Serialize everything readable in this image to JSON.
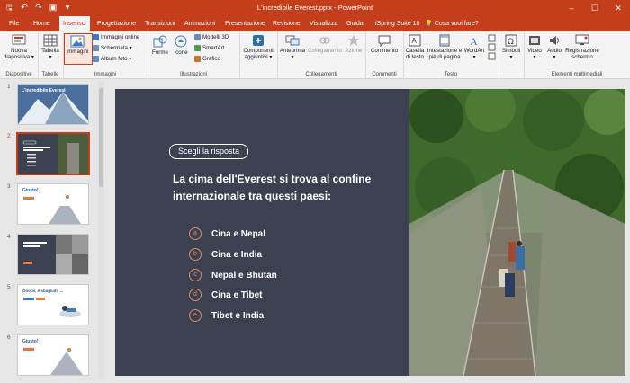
{
  "window": {
    "title": "L'incredibile Everest.pptx  -  PowerPoint",
    "minimize": "–",
    "maximize": "☐",
    "close": "✕"
  },
  "qat": {
    "save": "🖫",
    "undo": "↶",
    "redo": "↷",
    "present": "▣",
    "more": "▾"
  },
  "tabs": [
    {
      "label": "File"
    },
    {
      "label": "Home"
    },
    {
      "label": "Inserisci"
    },
    {
      "label": "Progettazione"
    },
    {
      "label": "Transizioni"
    },
    {
      "label": "Animazioni"
    },
    {
      "label": "Presentazione"
    },
    {
      "label": "Revisione"
    },
    {
      "label": "Visualizza"
    },
    {
      "label": "Guida"
    },
    {
      "label": "iSpring Suite 10"
    },
    {
      "label": "Cosa vuoi fare?"
    }
  ],
  "ribbon": {
    "groups": {
      "diapositive": "Diapositive",
      "tabelle": "Tabelle",
      "immagini": "Immagini",
      "illustrazioni": "Illustrazioni",
      "collegamenti": "Collegamenti",
      "commenti": "Commenti",
      "testo": "Testo",
      "media": "Elementi multimediali"
    },
    "buttons": {
      "nuova": "Nuova",
      "nuova2": "diapositiva ▾",
      "tabella": "Tabella",
      "tabella2": "▾",
      "immagini": "Immagini",
      "immagini_online": "Immagini online",
      "schermata": "Schermata ▾",
      "album": "Album foto ▾",
      "forme": "Forme",
      "icone": "Icone",
      "modelli3d": "Modelli 3D",
      "smartart": "SmartArt",
      "grafico": "Grafico",
      "componenti": "Componenti",
      "componenti2": "aggiuntivi ▾",
      "anteprima": "Anteprima",
      "anteprima2": "▾",
      "collegamento": "Collegamento",
      "azione": "Azione",
      "commento": "Commento",
      "casella": "Casella",
      "casella2": "di testo",
      "intestazione": "Intestazione e",
      "intestazione2": "piè di pagina",
      "wordart": "WordArt",
      "wordart2": "▾",
      "simboli": "Simboli",
      "simboli2": "▾",
      "video": "Video",
      "video2": "▾",
      "audio": "Audio",
      "audio2": "▾",
      "registrazione": "Registrazione",
      "registrazione2": "schermo"
    }
  },
  "thumbnails": [
    {
      "number": "1",
      "title": "L'incredibile Everest"
    },
    {
      "number": "2",
      "title": ""
    },
    {
      "number": "3",
      "title": "Giusto!"
    },
    {
      "number": "4",
      "title": ""
    },
    {
      "number": "5",
      "title": "Ooops, è sbagliato ..."
    },
    {
      "number": "6",
      "title": "Giusto!"
    }
  ],
  "slide": {
    "badge": "Scegli la risposta",
    "question": "La cima dell'Everest si trova al confine internazionale tra questi paesi:",
    "answers": [
      {
        "letter": "a",
        "text": "Cina e Nepal"
      },
      {
        "letter": "b",
        "text": "Cina e India"
      },
      {
        "letter": "c",
        "text": "Nepal e Bhutan"
      },
      {
        "letter": "d",
        "text": "Cina e Tibet"
      },
      {
        "letter": "e",
        "text": "Tibet e India"
      }
    ]
  },
  "colors": {
    "brand": "#c43e1c",
    "slide_bg": "#3b4150",
    "accent": "#e08a5d"
  }
}
